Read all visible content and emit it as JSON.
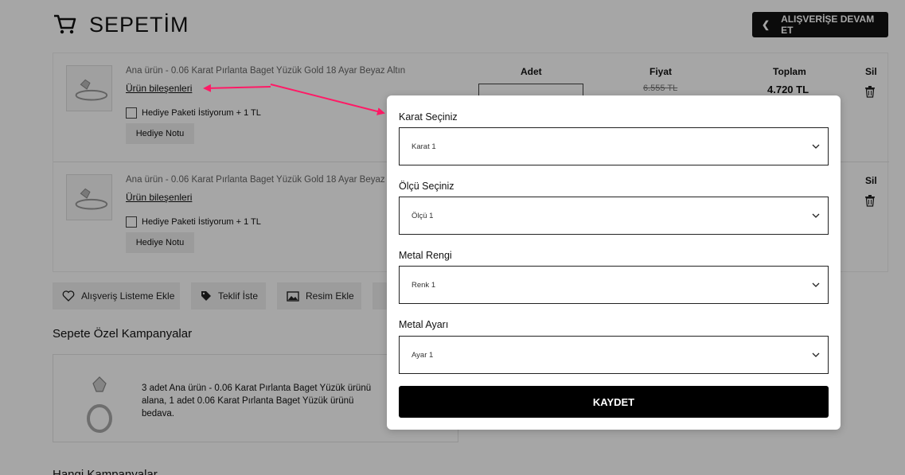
{
  "header": {
    "title": "SEPETİM",
    "continue_label": "ALIŞVERİŞE DEVAM ET"
  },
  "columns": {
    "qty": "Adet",
    "price": "Fiyat",
    "total": "Toplam",
    "delete": "Sil"
  },
  "cart_items": [
    {
      "name": "Ana ürün - 0.06 Karat Pırlanta Baget Yüzük Gold 18 Ayar Beyaz Altın",
      "components_link": "Ürün bileşenleri",
      "gift_label": "Hediye Paketi İstiyorum + 1 TL",
      "note_label": "Hediye Notu",
      "old_price": "6.555 TL",
      "total_price": "4.720 TL",
      "delete_label": "Sil"
    },
    {
      "name": "Ana ürün - 0.06 Karat Pırlanta Baget Yüzük Gold 18 Ayar Beyaz",
      "components_link": "Ürün bileşenleri",
      "gift_label": "Hediye Paketi İstiyorum + 1 TL",
      "note_label": "Hediye Notu",
      "delete_label": "Sil"
    }
  ],
  "actions": {
    "wishlist": "Alışveriş Listeme Ekle",
    "quote": "Teklif İste",
    "image": "Resim Ekle"
  },
  "campaigns": {
    "title": "Sepete Özel Kampanyalar",
    "text": "3 adet Ana ürün - 0.06 Karat Pırlanta Baget Yüzük ürünü alana, 1 adet 0.06 Karat Pırlanta Baget Yüzük ürünü bedava.",
    "next_title": "Hangi Kampanyalar"
  },
  "modal": {
    "fields": [
      {
        "label": "Karat Seçiniz",
        "value": "Karat 1"
      },
      {
        "label": "Ölçü Seçiniz",
        "value": "Ölçü 1"
      },
      {
        "label": "Metal Rengi",
        "value": "Renk 1"
      },
      {
        "label": "Metal Ayarı",
        "value": "Ayar 1"
      }
    ],
    "save_label": "KAYDET"
  },
  "colors": {
    "accent_arrow": "#ff1a66",
    "button_dark": "#111111"
  },
  "icons": [
    "cart-icon",
    "chevron-left-icon",
    "trash-icon",
    "heart-icon",
    "tag-icon",
    "image-icon",
    "chevron-down-icon",
    "ring-icon"
  ]
}
